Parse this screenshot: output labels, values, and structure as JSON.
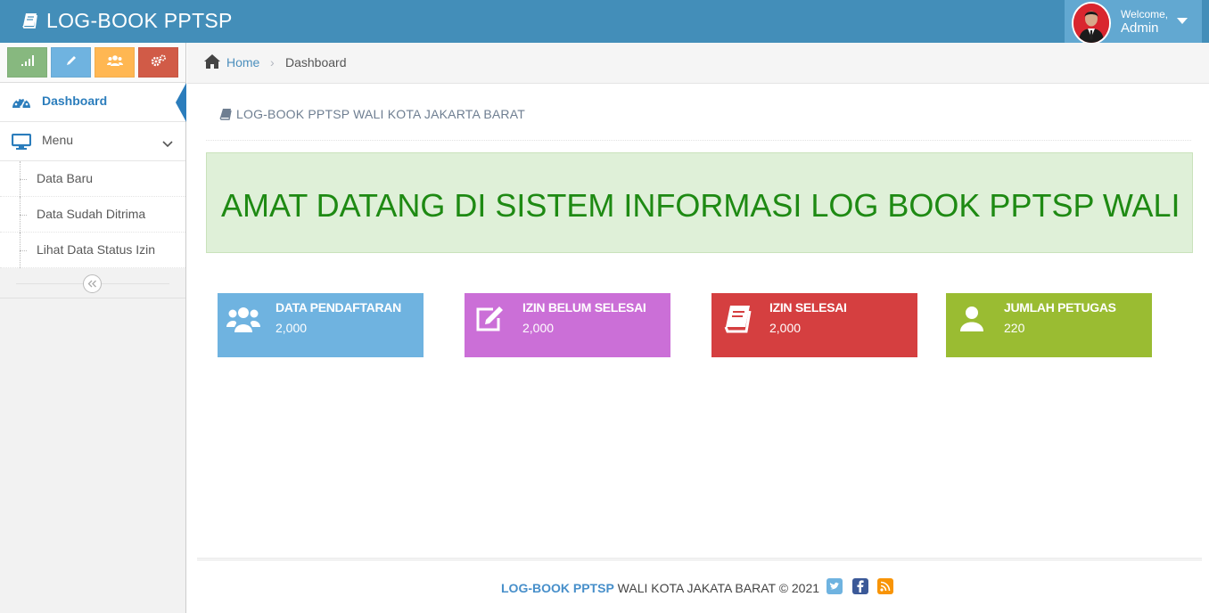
{
  "navbar": {
    "brand": "LOG-BOOK PPTSP",
    "welcome_label": "Welcome,",
    "user_name": "Admin"
  },
  "shortcuts": [
    {
      "icon": "signal-icon",
      "color": "#87b87f"
    },
    {
      "icon": "pencil-icon",
      "color": "#6fb3e0"
    },
    {
      "icon": "users-icon",
      "color": "#ffb752"
    },
    {
      "icon": "cogs-icon",
      "color": "#d15b47"
    }
  ],
  "sidebar": {
    "dashboard": "Dashboard",
    "menu": "Menu",
    "submenu": [
      "Data Baru",
      "Data Sudah Ditrima",
      "Lihat Data Status Izin"
    ]
  },
  "breadcrumb": {
    "home": "Home",
    "separator": "›",
    "current": "Dashboard"
  },
  "page_header": "LOG-BOOK PPTSP WALI KOTA JAKARTA BARAT",
  "banner": "AMAT DATANG DI SISTEM INFORMASI LOG BOOK PPTSP WALIKOTA JAKARTA BARAT",
  "stats": [
    {
      "title": "DATA PENDAFTARAN",
      "value": "2,000",
      "icon": "users-icon",
      "color": "#6fb3e0"
    },
    {
      "title": "IZIN BELUM SELESAI",
      "value": "2,000",
      "icon": "edit-icon",
      "color": "#cb6fd7"
    },
    {
      "title": "IZIN SELESAI",
      "value": "2,000",
      "icon": "book-icon",
      "color": "#d53f40"
    },
    {
      "title": "JUMLAH PETUGAS",
      "value": "220",
      "icon": "user-icon",
      "color": "#9abc32"
    }
  ],
  "footer": {
    "brand": "LOG-BOOK PPTSP",
    "text": " WALI KOTA JAKATA BARAT © 2021",
    "social": [
      "twitter-icon",
      "facebook-icon",
      "rss-icon"
    ]
  },
  "colors": {
    "navbar": "#438eb9",
    "active": "#2b7dbc",
    "banner_bg": "#dff0d8",
    "banner_text": "#1e8a13"
  }
}
